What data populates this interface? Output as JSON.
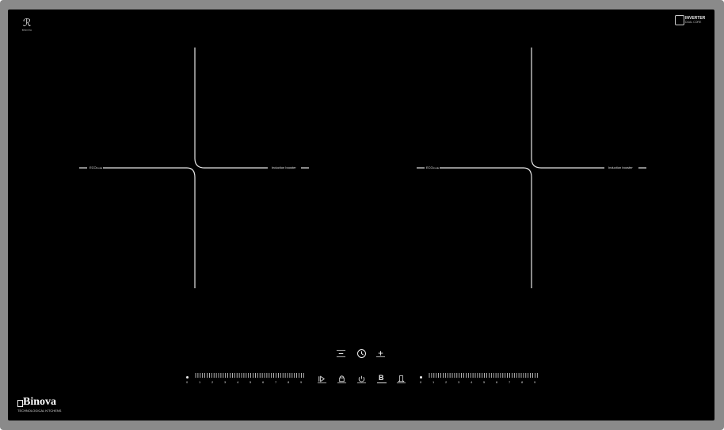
{
  "brand": {
    "mark_text": "BINOVA",
    "name": "Binova",
    "tagline": "TECHNOLOGICAL KITCHENS"
  },
  "inverter_badge": {
    "title": "INVERTER",
    "subtitle": "DUAL CORE"
  },
  "zones": [
    {
      "left_label": "ECO",
      "left_sub": "mode",
      "right_label": "Induction booster"
    },
    {
      "left_label": "ECO",
      "left_sub": "mode",
      "right_label": "Induction booster"
    }
  ],
  "timer_controls": {
    "minus_icon": "minus-icon",
    "clock_icon": "clock-icon",
    "plus_icon": "plus-icon"
  },
  "function_buttons": [
    {
      "icon": "pause-play-icon"
    },
    {
      "icon": "lock-icon"
    },
    {
      "icon": "power-icon"
    },
    {
      "icon": "booster-b-icon",
      "label": "B"
    },
    {
      "icon": "bridge-icon"
    }
  ],
  "slider_levels": [
    "0",
    "1",
    "2",
    "3",
    "4",
    "5",
    "6",
    "7",
    "8",
    "9"
  ],
  "colors": {
    "glass": "#000000",
    "frame": "#8a8a8a",
    "lines": "#e6e6e6"
  }
}
